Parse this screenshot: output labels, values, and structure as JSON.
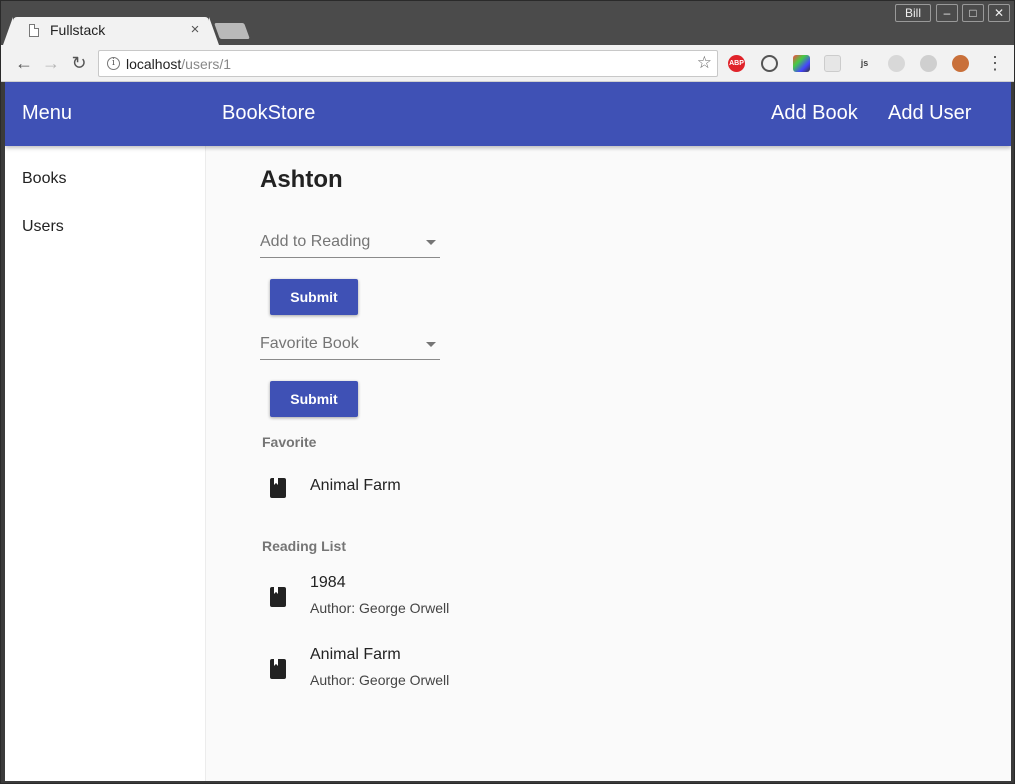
{
  "browser": {
    "tab_title": "Fullstack",
    "tab_close": "×",
    "profile_name": "Bill",
    "window_controls": {
      "minimize": "–",
      "maximize": "□",
      "close": "✕"
    },
    "url_host": "localhost",
    "url_path": "/users/1",
    "extensions": [
      "adblock-plus-icon",
      "sync-icon",
      "color-picker-icon",
      "grid-icon",
      "js-icon",
      "extension-icon",
      "extension-icon",
      "monkey-icon"
    ],
    "abp_label": "ABP",
    "js_label": "js"
  },
  "appbar": {
    "menu_label": "Menu",
    "brand": "BookStore",
    "add_book": "Add Book",
    "add_user": "Add User",
    "color": "#3f51b5"
  },
  "sidebar": {
    "items": [
      {
        "label": "Books"
      },
      {
        "label": "Users"
      }
    ]
  },
  "user": {
    "name": "Ashton"
  },
  "forms": {
    "reading_select_label": "Add to Reading",
    "reading_submit": "Submit",
    "favorite_select_label": "Favorite Book",
    "favorite_submit": "Submit"
  },
  "favorite": {
    "header": "Favorite",
    "items": [
      {
        "title": "Animal Farm"
      }
    ]
  },
  "reading_list": {
    "header": "Reading List",
    "items": [
      {
        "title": "1984",
        "author": "Author: George Orwell"
      },
      {
        "title": "Animal Farm",
        "author": "Author: George Orwell"
      }
    ]
  }
}
